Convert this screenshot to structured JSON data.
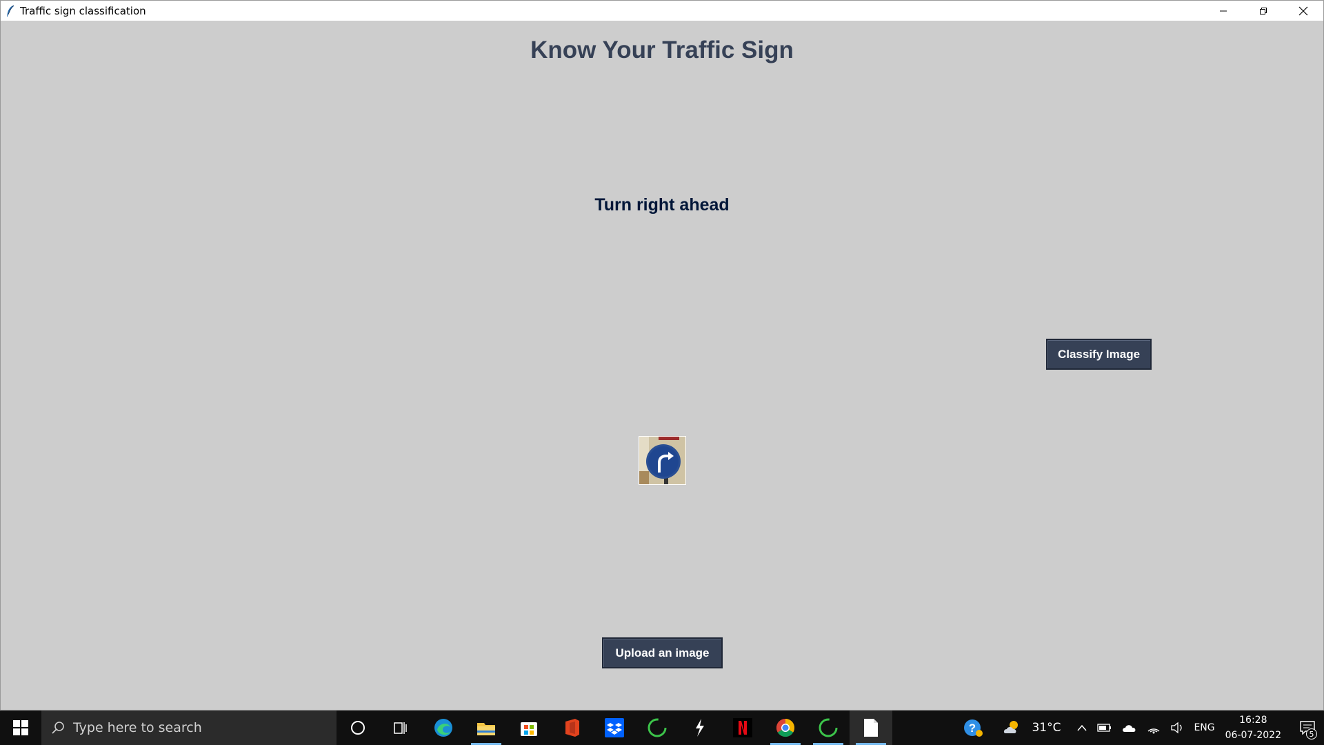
{
  "window": {
    "title": "Traffic sign classification"
  },
  "app": {
    "heading": "Know Your Traffic Sign",
    "result": "Turn right ahead",
    "classify_button": "Classify Image",
    "upload_button": "Upload an image"
  },
  "colors": {
    "background": "#cdcdcd",
    "heading": "#364156",
    "result": "#011638",
    "button_bg": "#364156",
    "button_text": "#ffffff"
  },
  "taskbar": {
    "search_placeholder": "Type here to search",
    "pinned": [
      "cortana-icon",
      "task-view-icon",
      "edge-icon",
      "file-explorer-icon",
      "store-icon",
      "office-icon",
      "dropbox-icon",
      "refresh-app-icon",
      "git-icon",
      "netflix-icon",
      "chrome-icon",
      "refresh-app-icon-2",
      "notepad-icon"
    ],
    "tray": {
      "temperature": "31°C",
      "language": "ENG",
      "time": "16:28",
      "date": "06-07-2022",
      "notification_count": "5"
    }
  }
}
